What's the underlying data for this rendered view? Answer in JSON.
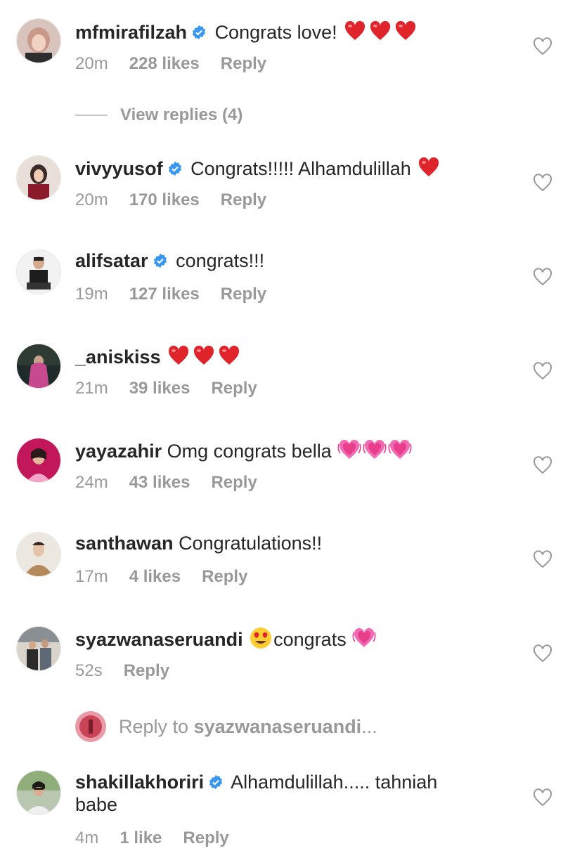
{
  "comments": [
    {
      "username": "mfmirafilzah",
      "verified": true,
      "text": "Congrats love!",
      "emojis": [
        "red-heart",
        "red-heart",
        "red-heart"
      ],
      "time": "20m",
      "likes": "228 likes",
      "reply": "Reply"
    },
    {
      "username": "vivyyusof",
      "verified": true,
      "text": "Congrats!!!!! Alhamdulillah",
      "emojis": [
        "red-heart"
      ],
      "time": "20m",
      "likes": "170 likes",
      "reply": "Reply"
    },
    {
      "username": "alifsatar",
      "verified": true,
      "text": "congrats!!!",
      "time": "19m",
      "likes": "127 likes",
      "reply": "Reply"
    },
    {
      "username": "_aniskiss",
      "verified": false,
      "text": "",
      "emojis": [
        "red-heart",
        "red-heart",
        "red-heart"
      ],
      "time": "21m",
      "likes": "39 likes",
      "reply": "Reply"
    },
    {
      "username": "yayazahir",
      "verified": false,
      "text": "Omg congrats bella",
      "emojis": [
        "growing-heart",
        "growing-heart",
        "growing-heart"
      ],
      "time": "24m",
      "likes": "43 likes",
      "reply": "Reply"
    },
    {
      "username": "santhawan",
      "verified": false,
      "text": "Congratulations!!",
      "time": "17m",
      "likes": "4 likes",
      "reply": "Reply"
    },
    {
      "username": "syazwanaseruandi",
      "verified": false,
      "text": "congrats",
      "emojis": [
        "heart-eyes-face",
        "growing-heart"
      ],
      "time": "52s",
      "likes": "",
      "reply": "Reply"
    },
    {
      "username": "shakillakhoriri",
      "verified": true,
      "text": "Alhamdulillah..... tahniah babe",
      "time": "4m",
      "likes": "1 like",
      "reply": "Reply"
    }
  ],
  "view_replies": "View replies (4)",
  "reply_to": {
    "prefix": "Reply to",
    "username": "syazwanaseruandi",
    "suffix": "..."
  },
  "icons": {
    "like": "heart-outline-icon",
    "verified": "verified-badge-icon"
  },
  "colors": {
    "text": "#262626",
    "secondary": "#999999",
    "verified": "#3897f0",
    "heart_red": "#e0242b",
    "heart_pink": "#e83e8c"
  }
}
